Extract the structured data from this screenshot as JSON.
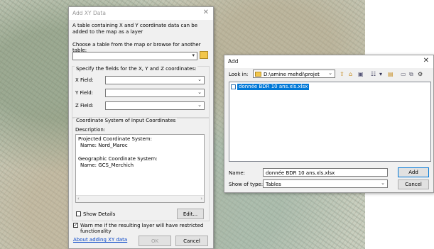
{
  "xy_dialog": {
    "title": "Add XY Data",
    "description": "A table containing X and Y coordinate data can be added to the map as a layer",
    "choose_table_label": "Choose a table from the map or browse for another table:",
    "table_value": "",
    "specify_fields_label": "Specify the fields for the X, Y and Z coordinates:",
    "x_field_label": "X Field:",
    "y_field_label": "Y Field:",
    "z_field_label": "Z Field:",
    "x_field_value": "",
    "y_field_value": "",
    "z_field_value": "",
    "coord_system_title": "Coordinate System of Input Coordinates",
    "description_label": "Description:",
    "description_lines": {
      "l1": "Projected Coordinate System:",
      "l2": "Name: Nord_Maroc",
      "l3": "Geographic Coordinate System:",
      "l4": "Name: GCS_Merchich"
    },
    "show_details_label": "Show Details",
    "show_details_checked": false,
    "edit_button": "Edit...",
    "warn_label": "Warn me if the resulting layer will have restricted functionality",
    "warn_checked": true,
    "help_link": "About adding XY data",
    "ok_button": "OK",
    "cancel_button": "Cancel"
  },
  "add_dialog": {
    "title": "Add",
    "look_in_label": "Look in:",
    "look_in_value": "D:\\amine mehdi\\projet",
    "files": [
      {
        "name": "donnée BDR 10 ans.xls.xlsx",
        "selected": true
      }
    ],
    "name_label": "Name:",
    "name_value": "donnée BDR 10 ans.xls.xlsx",
    "type_label": "Show of type:",
    "type_value": "Tables",
    "add_button": "Add",
    "cancel_button": "Cancel"
  },
  "colors": {
    "accent": "#0078d7",
    "selection": "#0078d7",
    "link": "#0645c8"
  }
}
